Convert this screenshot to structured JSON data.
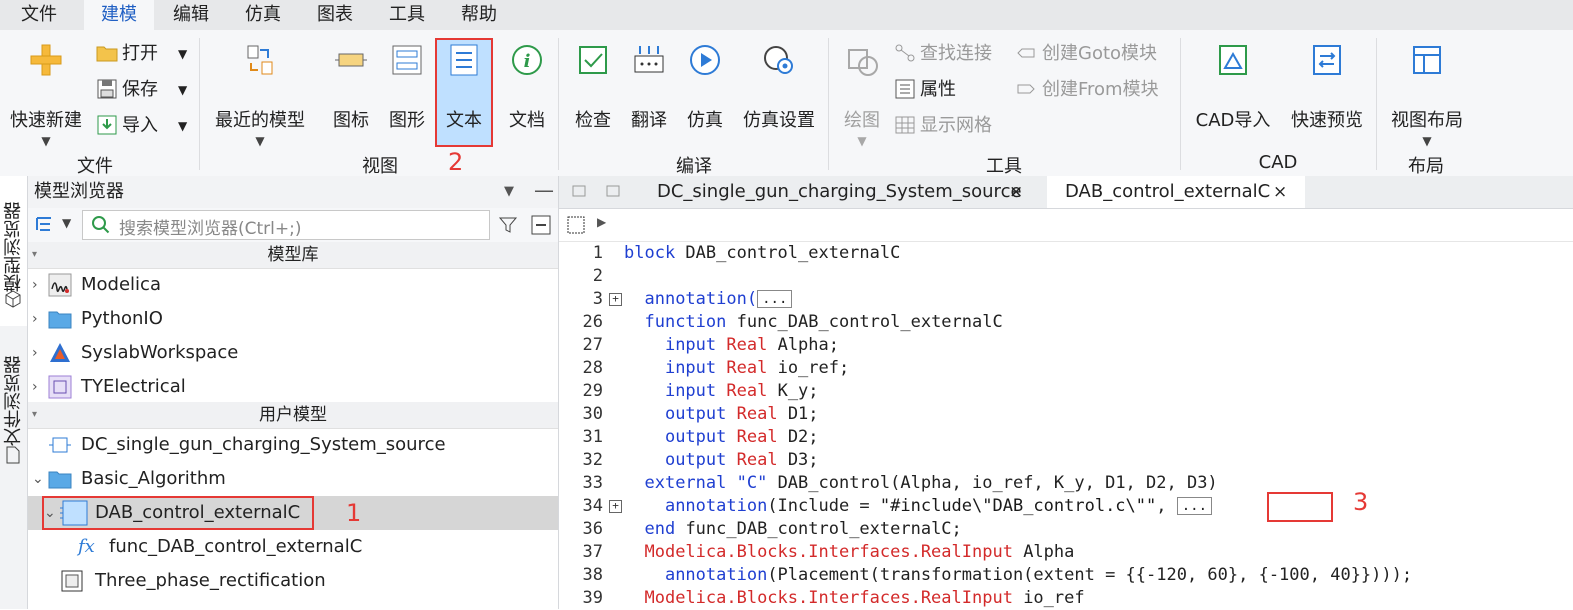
{
  "menu": [
    "文件",
    "建模",
    "编辑",
    "仿真",
    "图表",
    "工具",
    "帮助"
  ],
  "ribbon": {
    "quick_new": "快速新建",
    "open": "打开",
    "save": "保存",
    "import": "导入",
    "recent": "最近的模型",
    "icon": "图标",
    "diagram": "图形",
    "text": "文本",
    "doc": "文档",
    "check": "检查",
    "translate": "翻译",
    "simulate": "仿真",
    "sim_settings": "仿真设置",
    "draw": "绘图",
    "find_conn": "查找连接",
    "props": "属性",
    "show_grid": "显示网格",
    "goto": "创建Goto模块",
    "from": "创建From模块",
    "cad_import": "CAD导入",
    "quick_preview": "快速预览",
    "view_layout": "视图布局",
    "groups": {
      "file": "文件",
      "view": "视图",
      "compile": "编译",
      "tools": "工具",
      "cad": "CAD",
      "layout": "布局"
    }
  },
  "annotations": {
    "one": "1",
    "two": "2",
    "three": "3"
  },
  "side_tabs": {
    "model_browser": "模型浏览器",
    "file_browser": "文件浏览器"
  },
  "browser": {
    "title": "模型浏览器",
    "search_placeholder": "搜索模型浏览器(Ctrl+;)",
    "section_lib": "模型库",
    "section_user": "用户模型",
    "libs": [
      "Modelica",
      "PythonIO",
      "SyslabWorkspace",
      "TYElectrical"
    ],
    "user": [
      "DC_single_gun_charging_System_source",
      "Basic_Algorithm",
      "DAB_control_externalC",
      "func_DAB_control_externalC",
      "Three_phase_rectification"
    ]
  },
  "editor": {
    "tabs": [
      "DC_single_gun_charging_System_source",
      "DAB_control_externalC"
    ],
    "line_numbers": [
      "1",
      "2",
      "3",
      "26",
      "27",
      "28",
      "29",
      "30",
      "31",
      "32",
      "33",
      "34",
      "36",
      "37",
      "38",
      "39"
    ],
    "code": {
      "l1a": "block",
      "l1b": " DAB_control_externalC",
      "l3a": "annotation",
      "l3b": "(",
      "ellipsis": "...",
      "l26a": "function",
      "l26b": " func_DAB_control_externalC",
      "input": "input",
      "output": "output",
      "real": "Real",
      "v_alpha": " Alpha;",
      "v_ioref": " io_ref;",
      "v_ky": " K_y;",
      "v_d1": " D1;",
      "v_d2": " D2;",
      "v_d3": " D3;",
      "l33a": "external",
      "l33b": " \"C\"",
      "l33c": " DAB_control(Alpha, io_ref, K_y, D1, D2, D3)",
      "l34a": "annotation",
      "l34b": "(Include = ",
      "l34c": "\"#include\\\"DAB_control.c\\\"\"",
      "l34d": ", ",
      "l36a": "end",
      "l36b": " func_DAB_control_externalC;",
      "l37a": "Modelica.Blocks.Interfaces.RealInput",
      "l37b": " Alpha",
      "l38a": "annotation",
      "l38b": "(Placement(transformation(extent = {{-120, 60}, {-100, 40}})));",
      "l39a": "Modelica.Blocks.Interfaces.RealInput",
      "l39b": " io_ref"
    }
  }
}
